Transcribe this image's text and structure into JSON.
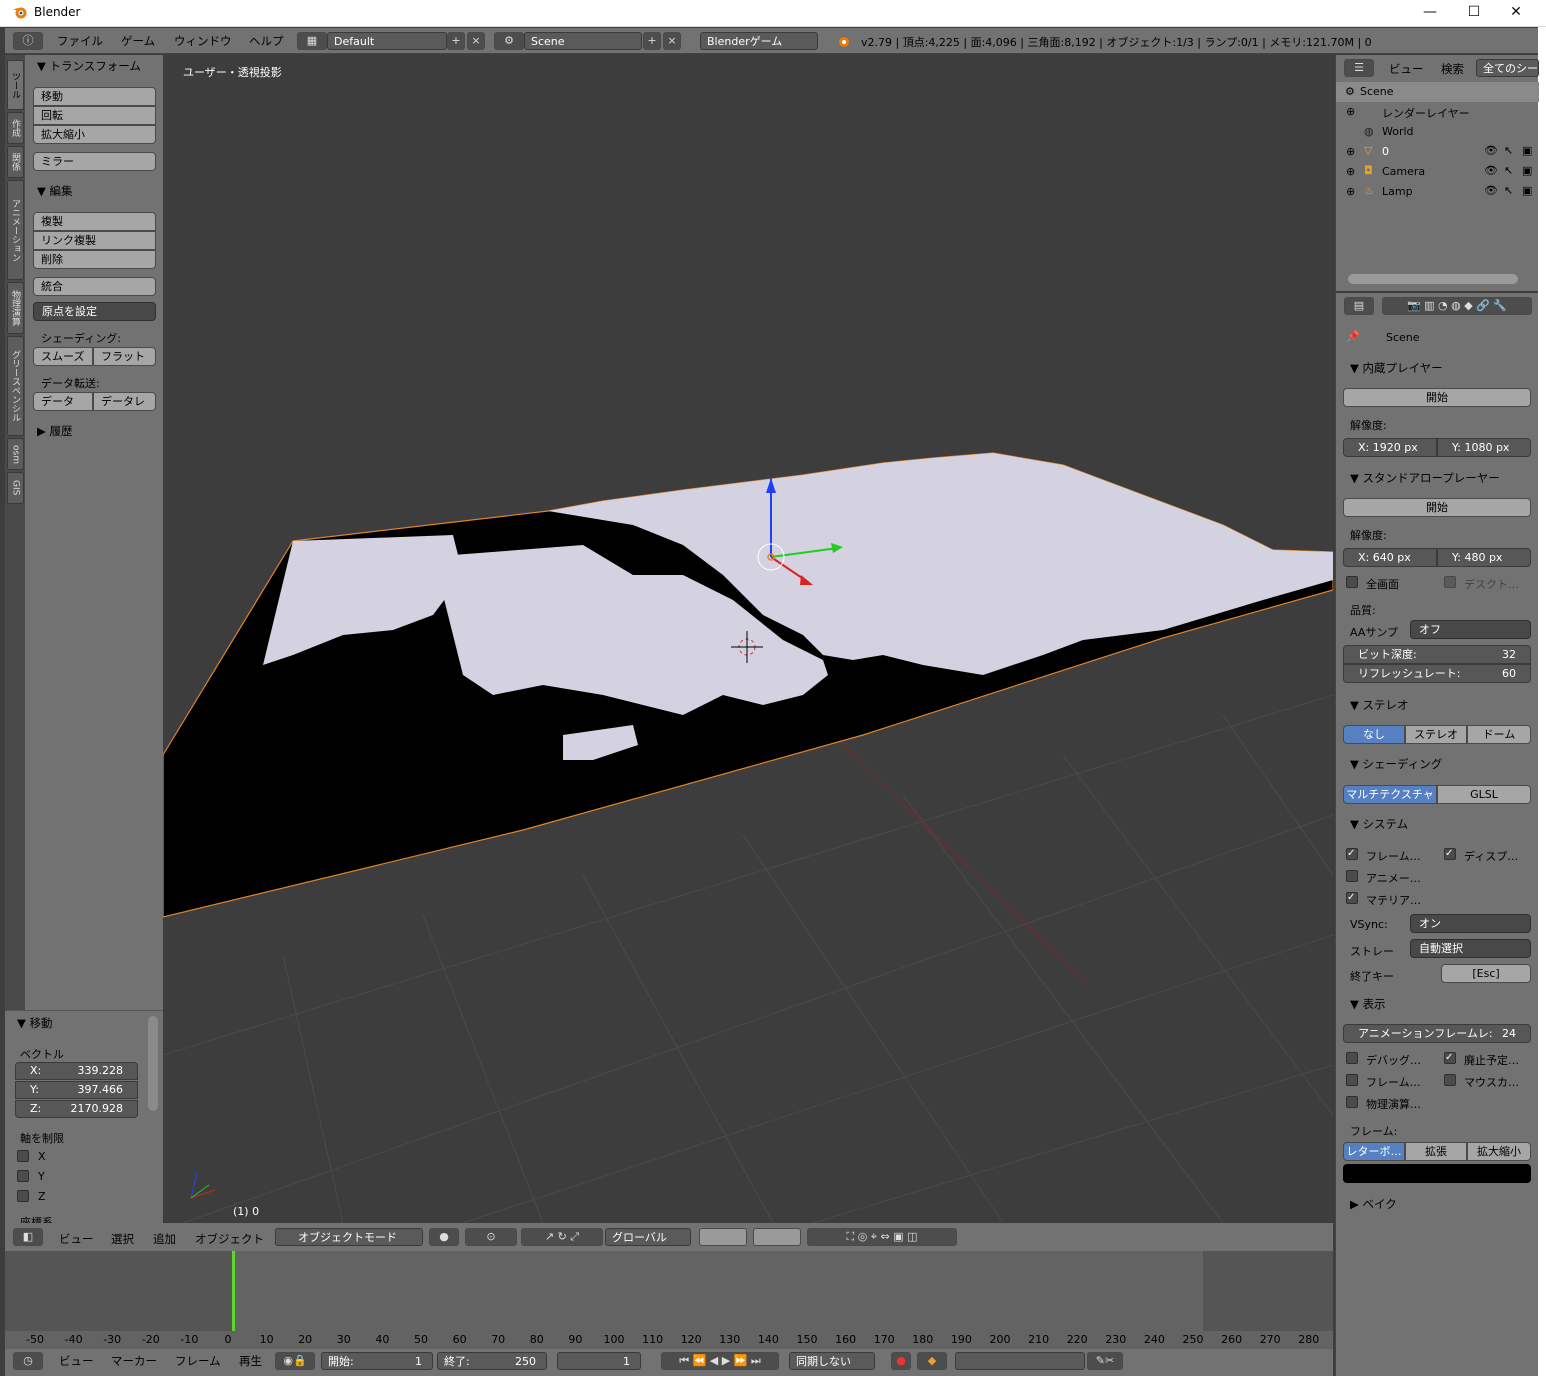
{
  "window": {
    "title": "Blender",
    "minimize": "—",
    "maximize": "☐",
    "close": "✕"
  },
  "info_header": {
    "menus": [
      "ファイル",
      "ゲーム",
      "ウィンドウ",
      "ヘルプ"
    ],
    "screen_layout": "Default",
    "scene": "Scene",
    "engine": "Blenderゲーム",
    "stats": "v2.79 | 頂点:4,225 | 面:4,096 | 三角面:8,192 | オブジェクト:1/3 | ランプ:0/1 | メモリ:121.70M | 0"
  },
  "tool_tabs": [
    "ツール",
    "作成",
    "関係",
    "アニメーション",
    "物理演算",
    "グリースペンシル",
    "osm",
    "GIS"
  ],
  "tool_panel": {
    "transform_title": "トランスフォーム",
    "translate": "移動",
    "rotate": "回転",
    "scale": "拡大縮小",
    "mirror": "ミラー",
    "edit_title": "編集",
    "duplicate": "複製",
    "duplicate_linked": "リンク複製",
    "delete": "削除",
    "join": "統合",
    "set_origin": "原点を設定",
    "shading_label": "シェーディング:",
    "smooth": "スムーズ",
    "flat": "フラット",
    "data_transfer_label": "データ転送:",
    "data": "データ",
    "data_layout": "データレ",
    "history_title": "履歴"
  },
  "redo_panel": {
    "title": "移動",
    "vector_label": "ベクトル",
    "x": {
      "k": "X:",
      "v": "339.228"
    },
    "y": {
      "k": "Y:",
      "v": "397.466"
    },
    "z": {
      "k": "Z:",
      "v": "2170.928"
    },
    "constraint_label": "軸を制限",
    "axes": [
      "X",
      "Y",
      "Z"
    ],
    "orient_label": "座標系"
  },
  "viewport": {
    "view_label": "ユーザー・透視投影",
    "object_label": "(1) 0"
  },
  "view3d_header": {
    "menus": [
      "ビュー",
      "選択",
      "追加",
      "オブジェクト"
    ],
    "mode": "オブジェクトモード",
    "orientation": "グローバル"
  },
  "timeline": {
    "ticks": [
      "-50",
      "-40",
      "-30",
      "-20",
      "-10",
      "0",
      "10",
      "20",
      "30",
      "40",
      "50",
      "60",
      "70",
      "80",
      "90",
      "100",
      "110",
      "120",
      "130",
      "140",
      "150",
      "160",
      "170",
      "180",
      "190",
      "200",
      "210",
      "220",
      "230",
      "240",
      "250",
      "260",
      "270",
      "280"
    ],
    "menus": [
      "ビュー",
      "マーカー",
      "フレーム",
      "再生"
    ],
    "start": {
      "k": "開始:",
      "v": "1"
    },
    "end": {
      "k": "終了:",
      "v": "250"
    },
    "current": "1",
    "sync": "同期しない"
  },
  "outliner": {
    "view": "ビュー",
    "search": "検索",
    "filter": "全てのシー",
    "items": [
      {
        "label": "Scene"
      },
      {
        "label": "レンダーレイヤー"
      },
      {
        "label": "World"
      },
      {
        "label": "0"
      },
      {
        "label": "Camera"
      },
      {
        "label": "Lamp"
      }
    ]
  },
  "properties": {
    "context": "Scene",
    "embedded_title": "内蔵プレイヤー",
    "start1": "開始",
    "res_label": "解像度:",
    "res1": {
      "x": "X:  1920 px",
      "y": "Y:  1080 px"
    },
    "standalone_title": "スタンドアロープレーヤー",
    "start2": "開始",
    "res2": {
      "x": "X:   640 px",
      "y": "Y:   480 px"
    },
    "fullscreen": "全画面",
    "desktop": "デスクト…",
    "quality_label": "品質:",
    "aa_label": "AAサンプ",
    "aa_value": "オフ",
    "bit_depth": {
      "k": "ビット深度:",
      "v": "32"
    },
    "refresh": {
      "k": "リフレッシュレート:",
      "v": "60"
    },
    "stereo_title": "ステレオ",
    "stereo_opts": [
      "なし",
      "ステレオ",
      "ドーム"
    ],
    "shading_title": "シェーディング",
    "shading_opts": [
      "マルチテクスチャ",
      "GLSL"
    ],
    "system_title": "システム",
    "sys_frame": "フレーム…",
    "sys_display": "ディスプ…",
    "sys_anim": "アニメー…",
    "sys_material": "マテリア…",
    "vsync_label": "VSync:",
    "vsync_value": "オン",
    "storage_label": "ストレー",
    "storage_value": "自動選択",
    "exit_label": "終了キー",
    "exit_value": "[Esc]",
    "display_title": "表示",
    "anim_frame": {
      "k": "アニメーションフレームレ:",
      "v": "24"
    },
    "debug": "デバッグ…",
    "deprecated": "廃止予定…",
    "framerate": "フレーム…",
    "mouse": "マウスカ…",
    "physics": "物理演算…",
    "frame_label": "フレーム:",
    "frame_opts": [
      "レターボ…",
      "拡張",
      "拡大縮小"
    ],
    "bake_title": "ベイク"
  }
}
